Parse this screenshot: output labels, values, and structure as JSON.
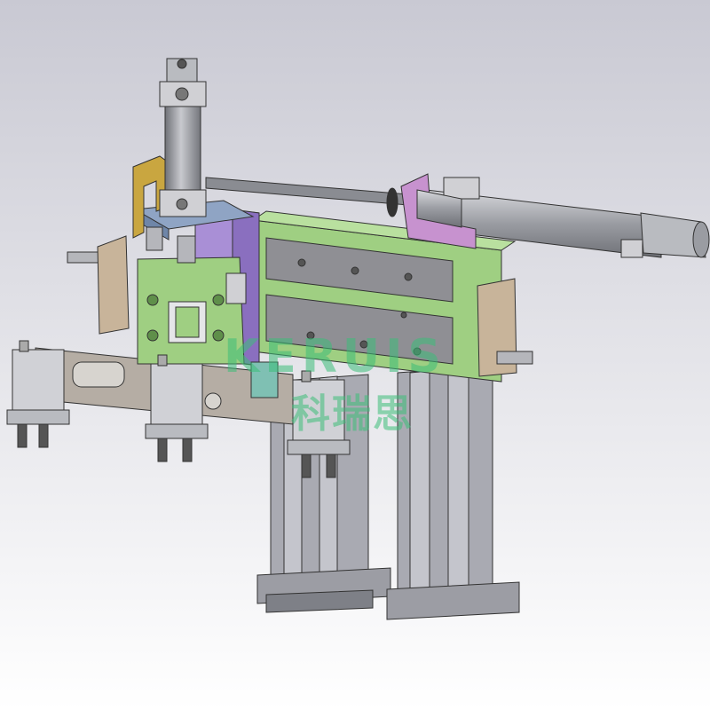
{
  "watermark": {
    "latin": "KERUIS",
    "chinese": "科瑞思"
  },
  "colors": {
    "background_top": "#c9c9d3",
    "background_bottom": "#ffffff",
    "green_frame": "#9fcf82",
    "green_frame_dark": "#5f8f4a",
    "purple_block": "#a98fd6",
    "blue_plate": "#8fa4c4",
    "tan_bracket": "#c8b49a",
    "mustard_bracket": "#c9a640",
    "magenta_bracket": "#c792cf",
    "taupe_arm": "#b5ada4",
    "rail_gray": "#8f8f94",
    "steel": "#a8aab0",
    "teal_block": "#7fc0b3"
  }
}
